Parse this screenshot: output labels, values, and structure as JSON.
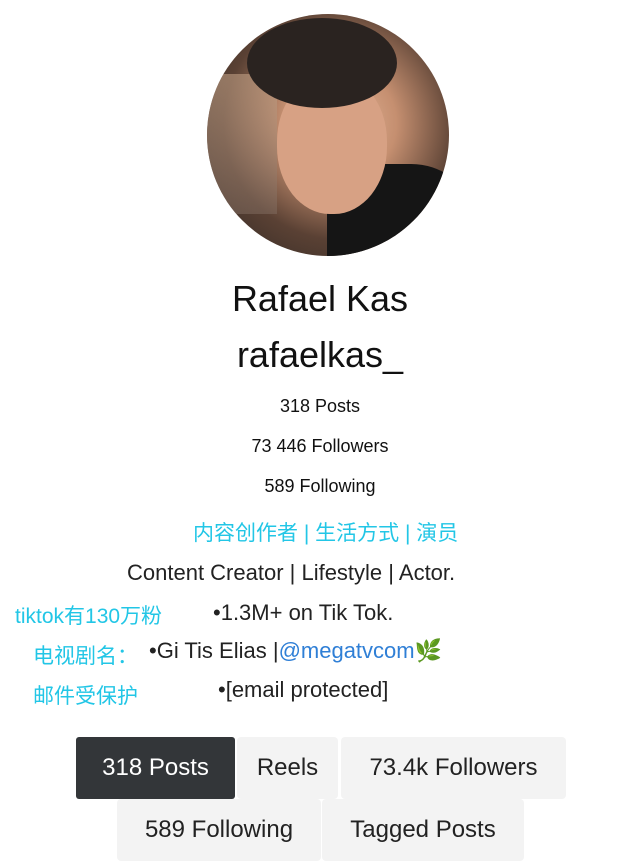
{
  "profile": {
    "display_name": "Rafael Kas",
    "username": "rafaelkas_",
    "posts": "318 Posts",
    "followers": "73 446 Followers",
    "following": "589 Following"
  },
  "bio": {
    "cn_line1": "内容创作者 | 生活方式 | 演员",
    "line1": "Content Creator | Lifestyle | Actor.",
    "cn_tiktok": "tiktok有130万粉",
    "tiktok": "•1.3M+ on Tik Tok.",
    "cn_tv": "电视剧名：",
    "tv_show": "•Gi Tis Elias |",
    "tv_link": "@megatvcom",
    "leaf_emoji": "🌿",
    "cn_email": "邮件受保护",
    "email": "•[email protected]"
  },
  "tabs": {
    "posts": "318 Posts",
    "reels": "Reels",
    "followers": "73.4k Followers",
    "following": "589 Following",
    "tagged": "Tagged Posts"
  },
  "colors": {
    "annotation_cyan": "#22c6e6",
    "link_blue": "#2f7fd6",
    "active_tab": "#333639"
  }
}
